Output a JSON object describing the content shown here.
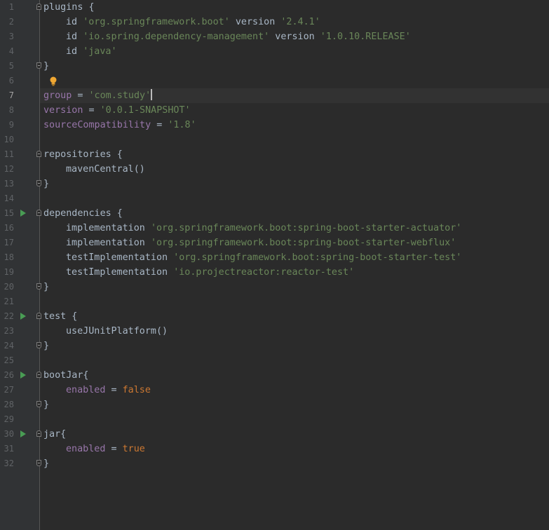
{
  "editor": {
    "active_line": 7,
    "lines": [
      {
        "num": "1",
        "indent": 0,
        "fold": "open",
        "run": false,
        "tokens": [
          {
            "t": "plugins {",
            "c": "plain"
          }
        ]
      },
      {
        "num": "2",
        "indent": 1,
        "fold": null,
        "run": false,
        "tokens": [
          {
            "t": "id ",
            "c": "plain"
          },
          {
            "t": "'org.springframework.boot'",
            "c": "str"
          },
          {
            "t": " version ",
            "c": "plain"
          },
          {
            "t": "'2.4.1'",
            "c": "str"
          }
        ]
      },
      {
        "num": "3",
        "indent": 1,
        "fold": null,
        "run": false,
        "tokens": [
          {
            "t": "id ",
            "c": "plain"
          },
          {
            "t": "'io.spring.dependency-management'",
            "c": "str"
          },
          {
            "t": " version ",
            "c": "plain"
          },
          {
            "t": "'1.0.10.RELEASE'",
            "c": "str"
          }
        ]
      },
      {
        "num": "4",
        "indent": 1,
        "fold": null,
        "run": false,
        "tokens": [
          {
            "t": "id ",
            "c": "plain"
          },
          {
            "t": "'java'",
            "c": "str"
          }
        ]
      },
      {
        "num": "5",
        "indent": 0,
        "fold": "close",
        "run": false,
        "tokens": [
          {
            "t": "}",
            "c": "plain"
          }
        ]
      },
      {
        "num": "6",
        "indent": 0,
        "fold": null,
        "run": false,
        "tokens": []
      },
      {
        "num": "7",
        "indent": 0,
        "fold": null,
        "run": false,
        "tokens": [
          {
            "t": "group",
            "c": "prop"
          },
          {
            "t": " = ",
            "c": "plain"
          },
          {
            "t": "'com.study'",
            "c": "str"
          }
        ]
      },
      {
        "num": "8",
        "indent": 0,
        "fold": null,
        "run": false,
        "tokens": [
          {
            "t": "version",
            "c": "prop"
          },
          {
            "t": " = ",
            "c": "plain"
          },
          {
            "t": "'0.0.1-SNAPSHOT'",
            "c": "str"
          }
        ]
      },
      {
        "num": "9",
        "indent": 0,
        "fold": null,
        "run": false,
        "tokens": [
          {
            "t": "sourceCompatibility",
            "c": "prop"
          },
          {
            "t": " = ",
            "c": "plain"
          },
          {
            "t": "'1.8'",
            "c": "str"
          }
        ]
      },
      {
        "num": "10",
        "indent": 0,
        "fold": null,
        "run": false,
        "tokens": []
      },
      {
        "num": "11",
        "indent": 0,
        "fold": "open",
        "run": false,
        "tokens": [
          {
            "t": "repositories {",
            "c": "plain"
          }
        ]
      },
      {
        "num": "12",
        "indent": 1,
        "fold": null,
        "run": false,
        "tokens": [
          {
            "t": "mavenCentral()",
            "c": "plain"
          }
        ]
      },
      {
        "num": "13",
        "indent": 0,
        "fold": "close",
        "run": false,
        "tokens": [
          {
            "t": "}",
            "c": "plain"
          }
        ]
      },
      {
        "num": "14",
        "indent": 0,
        "fold": null,
        "run": false,
        "tokens": []
      },
      {
        "num": "15",
        "indent": 0,
        "fold": "open",
        "run": true,
        "tokens": [
          {
            "t": "dependencies {",
            "c": "plain"
          }
        ]
      },
      {
        "num": "16",
        "indent": 1,
        "fold": null,
        "run": false,
        "tokens": [
          {
            "t": "implementation ",
            "c": "plain"
          },
          {
            "t": "'org.springframework.boot:spring-boot-starter-actuator'",
            "c": "str"
          }
        ]
      },
      {
        "num": "17",
        "indent": 1,
        "fold": null,
        "run": false,
        "tokens": [
          {
            "t": "implementation ",
            "c": "plain"
          },
          {
            "t": "'org.springframework.boot:spring-boot-starter-webflux'",
            "c": "str"
          }
        ]
      },
      {
        "num": "18",
        "indent": 1,
        "fold": null,
        "run": false,
        "tokens": [
          {
            "t": "testImplementation ",
            "c": "plain"
          },
          {
            "t": "'org.springframework.boot:spring-boot-starter-test'",
            "c": "str"
          }
        ]
      },
      {
        "num": "19",
        "indent": 1,
        "fold": null,
        "run": false,
        "tokens": [
          {
            "t": "testImplementation ",
            "c": "plain"
          },
          {
            "t": "'io.projectreactor:reactor-test'",
            "c": "str"
          }
        ]
      },
      {
        "num": "20",
        "indent": 0,
        "fold": "close",
        "run": false,
        "tokens": [
          {
            "t": "}",
            "c": "plain"
          }
        ]
      },
      {
        "num": "21",
        "indent": 0,
        "fold": null,
        "run": false,
        "tokens": []
      },
      {
        "num": "22",
        "indent": 0,
        "fold": "open",
        "run": true,
        "tokens": [
          {
            "t": "test {",
            "c": "plain"
          }
        ]
      },
      {
        "num": "23",
        "indent": 1,
        "fold": null,
        "run": false,
        "tokens": [
          {
            "t": "useJUnitPlatform()",
            "c": "plain"
          }
        ]
      },
      {
        "num": "24",
        "indent": 0,
        "fold": "close",
        "run": false,
        "tokens": [
          {
            "t": "}",
            "c": "plain"
          }
        ]
      },
      {
        "num": "25",
        "indent": 0,
        "fold": null,
        "run": false,
        "tokens": []
      },
      {
        "num": "26",
        "indent": 0,
        "fold": "open",
        "run": true,
        "tokens": [
          {
            "t": "bootJar{",
            "c": "plain"
          }
        ]
      },
      {
        "num": "27",
        "indent": 1,
        "fold": null,
        "run": false,
        "tokens": [
          {
            "t": "enabled",
            "c": "prop"
          },
          {
            "t": " = ",
            "c": "plain"
          },
          {
            "t": "false",
            "c": "kw"
          }
        ]
      },
      {
        "num": "28",
        "indent": 0,
        "fold": "close",
        "run": false,
        "tokens": [
          {
            "t": "}",
            "c": "plain"
          }
        ]
      },
      {
        "num": "29",
        "indent": 0,
        "fold": null,
        "run": false,
        "tokens": []
      },
      {
        "num": "30",
        "indent": 0,
        "fold": "open",
        "run": true,
        "tokens": [
          {
            "t": "jar{",
            "c": "plain"
          }
        ]
      },
      {
        "num": "31",
        "indent": 1,
        "fold": null,
        "run": false,
        "tokens": [
          {
            "t": "enabled",
            "c": "prop"
          },
          {
            "t": " = ",
            "c": "plain"
          },
          {
            "t": "true",
            "c": "kw"
          }
        ]
      },
      {
        "num": "32",
        "indent": 0,
        "fold": "close",
        "run": false,
        "tokens": [
          {
            "t": "}",
            "c": "plain"
          }
        ]
      }
    ]
  },
  "theme": {
    "background": "#2b2b2b",
    "gutter": "#313335",
    "string": "#6a8759",
    "property": "#9876aa",
    "keyword": "#cc7832",
    "text": "#a9b7c6",
    "run_icon": "#499c54",
    "bulb_icon": "#f0a732"
  },
  "icons": {
    "run": "run-gutter-icon",
    "fold": "fold-marker-icon",
    "intention": "lightbulb-icon"
  }
}
